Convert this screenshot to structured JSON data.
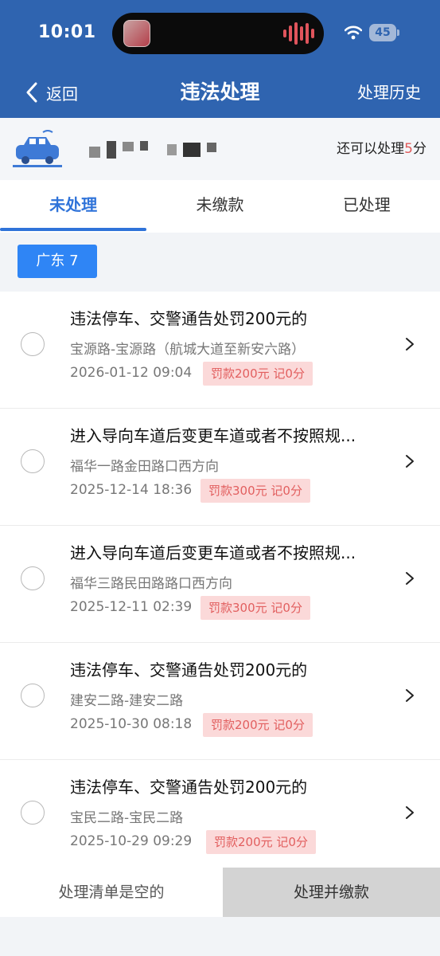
{
  "status_bar": {
    "time": "10:01",
    "battery": "45"
  },
  "nav": {
    "back_label": "返回",
    "title": "违法处理",
    "history_label": "处理历史"
  },
  "vehicle": {
    "remaining_prefix": "还可以处理",
    "remaining_points": "5",
    "remaining_suffix": "分"
  },
  "tabs": [
    {
      "label": "未处理",
      "active": true
    },
    {
      "label": "未缴款",
      "active": false
    },
    {
      "label": "已处理",
      "active": false
    }
  ],
  "region": {
    "label": "广东 7"
  },
  "violations": [
    {
      "title": "违法停车、交警通告处罚200元的",
      "location": "宝源路-宝源路（航城大道至新安六路）",
      "datetime": "2026-01-12 09:04",
      "fine": "罚款200元 记0分"
    },
    {
      "title": "进入导向车道后变更车道或者不按照规...",
      "location": "福华一路金田路口西方向",
      "datetime": "2025-12-14 18:36",
      "fine": "罚款300元 记0分"
    },
    {
      "title": "进入导向车道后变更车道或者不按照规...",
      "location": "福华三路民田路路口西方向",
      "datetime": "2025-12-11 02:39",
      "fine": "罚款300元 记0分"
    },
    {
      "title": "违法停车、交警通告处罚200元的",
      "location": "建安二路-建安二路",
      "datetime": "2025-10-30 08:18",
      "fine": "罚款200元 记0分"
    },
    {
      "title": "违法停车、交警通告处罚200元的",
      "location": "宝民二路-宝民二路",
      "datetime": "2025-10-29 09:29",
      "fine": "罚款200元 记0分"
    }
  ],
  "bottom": {
    "empty_text": "处理清单是空的",
    "pay_button": "处理并缴款"
  },
  "colors": {
    "header": "#2f64b0",
    "accent": "#2f73d9",
    "chip": "#2f85f5",
    "fine_bg": "#fbd9d9",
    "fine_text": "#e25f5f"
  },
  "icons": {
    "back": "chevron-left-icon",
    "car": "car-icon",
    "chevron": "chevron-right-icon",
    "wifi": "wifi-icon"
  }
}
